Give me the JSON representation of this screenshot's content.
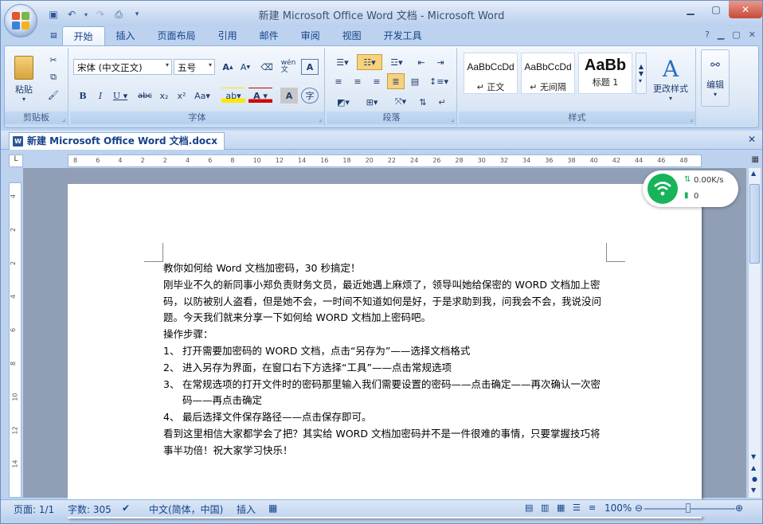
{
  "window": {
    "title": "新建 Microsoft Office Word 文档 - Microsoft Word"
  },
  "tabs": [
    {
      "label": "开始",
      "active": true
    },
    {
      "label": "插入"
    },
    {
      "label": "页面布局"
    },
    {
      "label": "引用"
    },
    {
      "label": "邮件"
    },
    {
      "label": "审阅"
    },
    {
      "label": "视图"
    },
    {
      "label": "开发工具"
    }
  ],
  "ribbon": {
    "clipboard": {
      "label": "剪贴板",
      "paste_label": "粘贴"
    },
    "font": {
      "label": "字体",
      "font_name": "宋体 (中文正文)",
      "font_size": "五号"
    },
    "paragraph": {
      "label": "段落"
    },
    "styles": {
      "label": "样式",
      "items": [
        {
          "sample": "AaBbCcDd",
          "name": "↵ 正文"
        },
        {
          "sample": "AaBbCcDd",
          "name": "↵ 无间隔"
        },
        {
          "sample": "AaBb",
          "name": "标题 1"
        }
      ],
      "change_label": "更改样式"
    },
    "editing": {
      "label": "编辑"
    }
  },
  "doc_tab": {
    "title": "新建 Microsoft Office Word 文档.docx"
  },
  "ruler": {
    "ticks": [
      "8",
      "6",
      "4",
      "2",
      "2",
      "4",
      "6",
      "8",
      "10",
      "12",
      "14",
      "16",
      "18",
      "20",
      "22",
      "24",
      "26",
      "28",
      "30",
      "32",
      "34",
      "36",
      "38",
      "40",
      "42",
      "44",
      "46",
      "48"
    ],
    "v_ticks": [
      "4",
      "2",
      "2",
      "4",
      "6",
      "8",
      "10",
      "12",
      "14"
    ]
  },
  "network": {
    "speed": "0.00K/s",
    "count": "0"
  },
  "document": {
    "paragraphs": [
      "教你如何给 Word 文档加密码，30 秒搞定！",
      "刚毕业不久的新同事小郑负责财务文员，最近她遇上麻烦了，领导叫她给保密的 WORD 文档加上密码，以防被别人盗看，但是她不会，一时间不知道如何是好，于是求助到我，问我会不会，我说没问题。今天我们就来分享一下如何给 WORD 文档加上密码吧。",
      "操作步骤："
    ],
    "steps": [
      {
        "num": "1、",
        "text": "打开需要加密码的 WORD 文档，点击“另存为”——选择文档格式"
      },
      {
        "num": "2、",
        "text": "进入另存为界面，在窗口右下方选择“工具”——点击常规选项"
      },
      {
        "num": "3、",
        "text": "在常规选项的打开文件时的密码那里输入我们需要设置的密码——点击确定——再次确认一次密码——再点击确定"
      },
      {
        "num": "4、",
        "text": "最后选择文件保存路径——点击保存即可。"
      }
    ],
    "closing": "看到这里相信大家都学会了把？其实给 WORD 文档加密码并不是一件很难的事情，只要掌握技巧将事半功倍！祝大家学习快乐！"
  },
  "status": {
    "page": "页面: 1/1",
    "words": "字数: 305",
    "language": "中文(简体，中国)",
    "mode": "插入",
    "zoom": "100%"
  }
}
